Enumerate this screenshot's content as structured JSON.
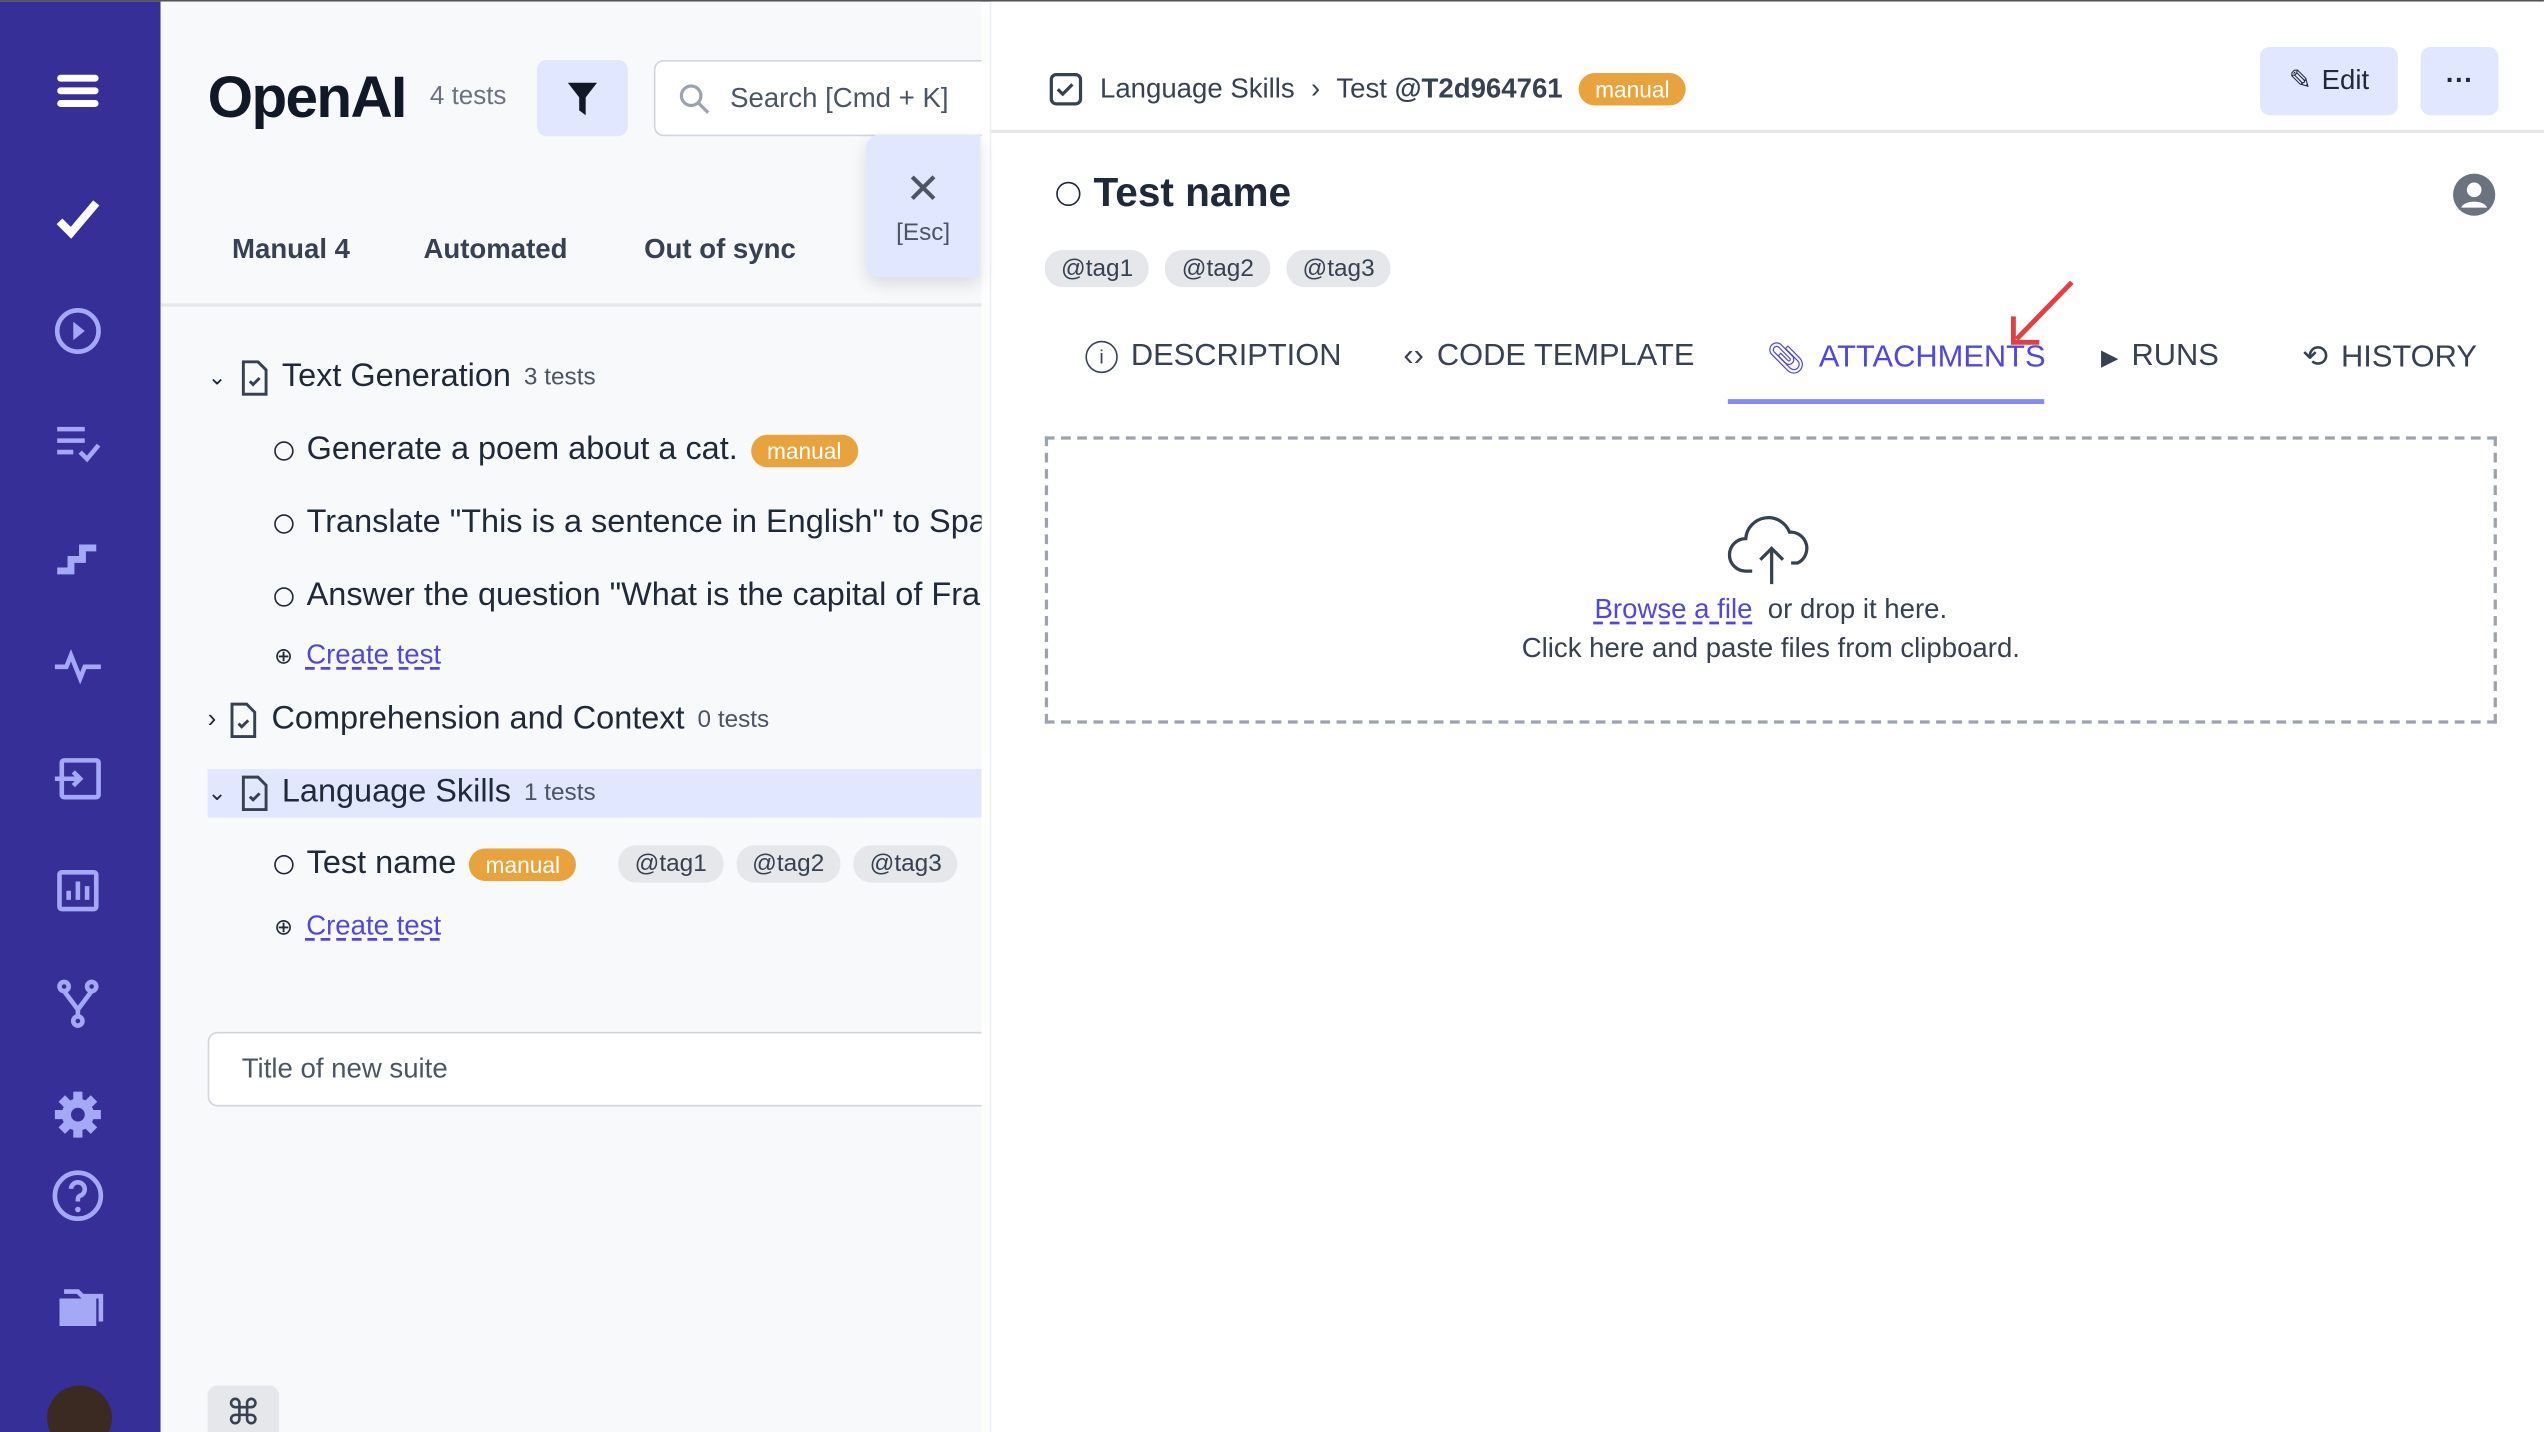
{
  "sidebar": {
    "items": [
      {
        "icon": "menu-icon"
      },
      {
        "icon": "check-icon",
        "active": true
      },
      {
        "icon": "play-circle-icon"
      },
      {
        "icon": "list-check-icon"
      },
      {
        "icon": "steps-icon"
      },
      {
        "icon": "pulse-icon"
      },
      {
        "icon": "import-icon"
      },
      {
        "icon": "chart-icon"
      },
      {
        "icon": "branch-icon"
      },
      {
        "icon": "gear-icon"
      },
      {
        "icon": "help-icon"
      },
      {
        "icon": "folder-icon"
      },
      {
        "icon": "avatar"
      }
    ],
    "colors": {
      "bg": "#372f98",
      "icon": "#a5a8f5",
      "active": "#ffffff"
    }
  },
  "left": {
    "title": "OpenAI",
    "count": "4 tests",
    "search_placeholder": "Search [Cmd + K]",
    "close_label": "[Esc]",
    "tabs": [
      "Manual 4",
      "Automated",
      "Out of sync"
    ],
    "suites": [
      {
        "name": "Text Generation",
        "count": "3 tests",
        "tests": [
          {
            "name": "Generate a poem about a cat.",
            "badge": "manual"
          },
          {
            "name": "Translate \"This is a sentence in English\" to Spa"
          },
          {
            "name": "Answer the question \"What is the capital of Fra"
          }
        ],
        "create": "Create test"
      },
      {
        "name": "Comprehension and Context",
        "count": "0 tests"
      },
      {
        "name": "Language Skills",
        "count": "1 tests",
        "tests": [
          {
            "name": "Test name",
            "badge": "manual",
            "tags": [
              "@tag1",
              "@tag2",
              "@tag3"
            ]
          }
        ],
        "create": "Create test"
      }
    ],
    "new_suite_placeholder": "Title of new suite",
    "cmd_symbol": "⌘"
  },
  "detail": {
    "breadcrumb": {
      "suite": "Language Skills",
      "sep": "›",
      "test_prefix": "Test",
      "test_id": "@T2d964761",
      "badge": "manual"
    },
    "edit": "Edit",
    "more": "···",
    "title": "Test name",
    "tags": [
      "@tag1",
      "@tag2",
      "@tag3"
    ],
    "tabs": [
      "DESCRIPTION",
      "CODE TEMPLATE",
      "ATTACHMENTS",
      "RUNS",
      "HISTORY"
    ],
    "active_tab": "ATTACHMENTS",
    "drop": {
      "browse": "Browse a file",
      "or": "or drop it here.",
      "paste": "Click here and paste files from clipboard."
    },
    "accent": "#4f46e5",
    "badge_color": "#e8a33d",
    "annotation_arrow_color": "#e53e3e"
  }
}
